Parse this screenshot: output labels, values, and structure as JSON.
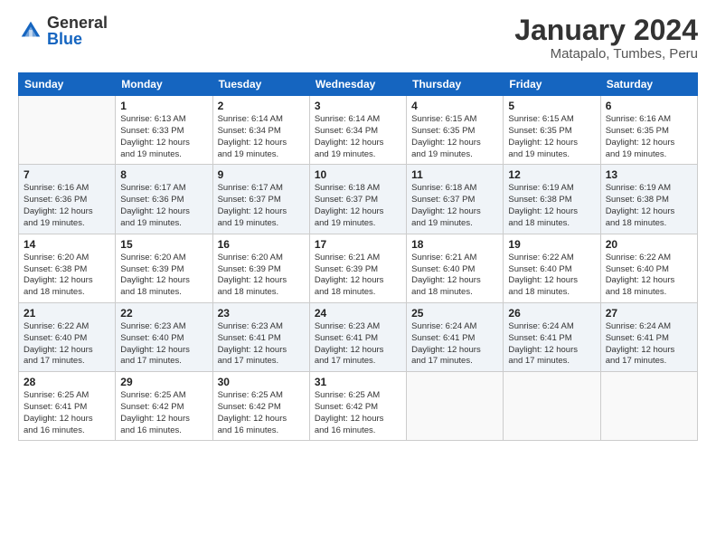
{
  "header": {
    "logo": {
      "general": "General",
      "blue": "Blue"
    },
    "title": "January 2024",
    "location": "Matapalo, Tumbes, Peru"
  },
  "weekdays": [
    "Sunday",
    "Monday",
    "Tuesday",
    "Wednesday",
    "Thursday",
    "Friday",
    "Saturday"
  ],
  "weeks": [
    [
      {
        "day": "",
        "info": ""
      },
      {
        "day": "1",
        "info": "Sunrise: 6:13 AM\nSunset: 6:33 PM\nDaylight: 12 hours\nand 19 minutes."
      },
      {
        "day": "2",
        "info": "Sunrise: 6:14 AM\nSunset: 6:34 PM\nDaylight: 12 hours\nand 19 minutes."
      },
      {
        "day": "3",
        "info": "Sunrise: 6:14 AM\nSunset: 6:34 PM\nDaylight: 12 hours\nand 19 minutes."
      },
      {
        "day": "4",
        "info": "Sunrise: 6:15 AM\nSunset: 6:35 PM\nDaylight: 12 hours\nand 19 minutes."
      },
      {
        "day": "5",
        "info": "Sunrise: 6:15 AM\nSunset: 6:35 PM\nDaylight: 12 hours\nand 19 minutes."
      },
      {
        "day": "6",
        "info": "Sunrise: 6:16 AM\nSunset: 6:35 PM\nDaylight: 12 hours\nand 19 minutes."
      }
    ],
    [
      {
        "day": "7",
        "info": "Sunrise: 6:16 AM\nSunset: 6:36 PM\nDaylight: 12 hours\nand 19 minutes."
      },
      {
        "day": "8",
        "info": "Sunrise: 6:17 AM\nSunset: 6:36 PM\nDaylight: 12 hours\nand 19 minutes."
      },
      {
        "day": "9",
        "info": "Sunrise: 6:17 AM\nSunset: 6:37 PM\nDaylight: 12 hours\nand 19 minutes."
      },
      {
        "day": "10",
        "info": "Sunrise: 6:18 AM\nSunset: 6:37 PM\nDaylight: 12 hours\nand 19 minutes."
      },
      {
        "day": "11",
        "info": "Sunrise: 6:18 AM\nSunset: 6:37 PM\nDaylight: 12 hours\nand 19 minutes."
      },
      {
        "day": "12",
        "info": "Sunrise: 6:19 AM\nSunset: 6:38 PM\nDaylight: 12 hours\nand 18 minutes."
      },
      {
        "day": "13",
        "info": "Sunrise: 6:19 AM\nSunset: 6:38 PM\nDaylight: 12 hours\nand 18 minutes."
      }
    ],
    [
      {
        "day": "14",
        "info": "Sunrise: 6:20 AM\nSunset: 6:38 PM\nDaylight: 12 hours\nand 18 minutes."
      },
      {
        "day": "15",
        "info": "Sunrise: 6:20 AM\nSunset: 6:39 PM\nDaylight: 12 hours\nand 18 minutes."
      },
      {
        "day": "16",
        "info": "Sunrise: 6:20 AM\nSunset: 6:39 PM\nDaylight: 12 hours\nand 18 minutes."
      },
      {
        "day": "17",
        "info": "Sunrise: 6:21 AM\nSunset: 6:39 PM\nDaylight: 12 hours\nand 18 minutes."
      },
      {
        "day": "18",
        "info": "Sunrise: 6:21 AM\nSunset: 6:40 PM\nDaylight: 12 hours\nand 18 minutes."
      },
      {
        "day": "19",
        "info": "Sunrise: 6:22 AM\nSunset: 6:40 PM\nDaylight: 12 hours\nand 18 minutes."
      },
      {
        "day": "20",
        "info": "Sunrise: 6:22 AM\nSunset: 6:40 PM\nDaylight: 12 hours\nand 18 minutes."
      }
    ],
    [
      {
        "day": "21",
        "info": "Sunrise: 6:22 AM\nSunset: 6:40 PM\nDaylight: 12 hours\nand 17 minutes."
      },
      {
        "day": "22",
        "info": "Sunrise: 6:23 AM\nSunset: 6:40 PM\nDaylight: 12 hours\nand 17 minutes."
      },
      {
        "day": "23",
        "info": "Sunrise: 6:23 AM\nSunset: 6:41 PM\nDaylight: 12 hours\nand 17 minutes."
      },
      {
        "day": "24",
        "info": "Sunrise: 6:23 AM\nSunset: 6:41 PM\nDaylight: 12 hours\nand 17 minutes."
      },
      {
        "day": "25",
        "info": "Sunrise: 6:24 AM\nSunset: 6:41 PM\nDaylight: 12 hours\nand 17 minutes."
      },
      {
        "day": "26",
        "info": "Sunrise: 6:24 AM\nSunset: 6:41 PM\nDaylight: 12 hours\nand 17 minutes."
      },
      {
        "day": "27",
        "info": "Sunrise: 6:24 AM\nSunset: 6:41 PM\nDaylight: 12 hours\nand 17 minutes."
      }
    ],
    [
      {
        "day": "28",
        "info": "Sunrise: 6:25 AM\nSunset: 6:41 PM\nDaylight: 12 hours\nand 16 minutes."
      },
      {
        "day": "29",
        "info": "Sunrise: 6:25 AM\nSunset: 6:42 PM\nDaylight: 12 hours\nand 16 minutes."
      },
      {
        "day": "30",
        "info": "Sunrise: 6:25 AM\nSunset: 6:42 PM\nDaylight: 12 hours\nand 16 minutes."
      },
      {
        "day": "31",
        "info": "Sunrise: 6:25 AM\nSunset: 6:42 PM\nDaylight: 12 hours\nand 16 minutes."
      },
      {
        "day": "",
        "info": ""
      },
      {
        "day": "",
        "info": ""
      },
      {
        "day": "",
        "info": ""
      }
    ]
  ]
}
